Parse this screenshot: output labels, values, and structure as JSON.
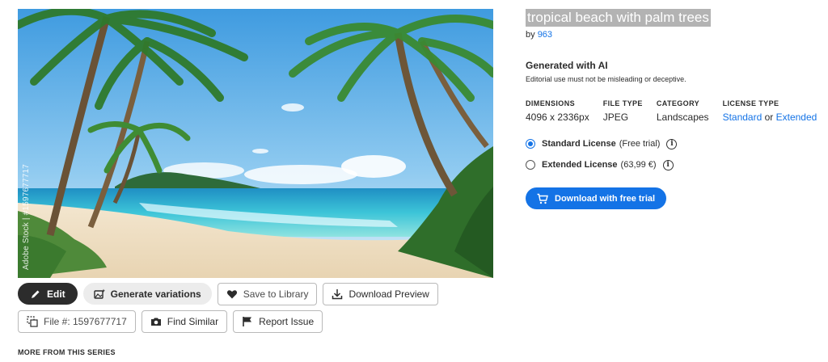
{
  "image": {
    "watermark": "Adobe Stock | #1597677717"
  },
  "actions": {
    "edit": "Edit",
    "generate": "Generate variations",
    "save": "Save to Library",
    "download_preview": "Download Preview",
    "file_no": "File #: 1597677717",
    "find_similar": "Find Similar",
    "report": "Report Issue"
  },
  "more_label": "MORE FROM THIS SERIES",
  "asset": {
    "title": "tropical beach with palm trees",
    "by_prefix": "by",
    "author": "963",
    "ai_heading": "Generated with AI",
    "ai_note": "Editorial use must not be misleading or deceptive."
  },
  "specs": {
    "dimensions_label": "DIMENSIONS",
    "dimensions": "4096 x 2336px",
    "filetype_label": "FILE TYPE",
    "filetype": "JPEG",
    "category_label": "CATEGORY",
    "category": "Landscapes",
    "license_label": "LICENSE TYPE",
    "license_standard": "Standard",
    "license_or": "or",
    "license_extended": "Extended"
  },
  "licenses": {
    "standard_name": "Standard License",
    "standard_note": "(Free trial)",
    "extended_name": "Extended License",
    "extended_note": "(63,99 €)",
    "selected": "standard"
  },
  "download": {
    "label": "Download with free trial"
  },
  "colors": {
    "accent": "#1473e6",
    "dark_button": "#2c2c2c"
  }
}
